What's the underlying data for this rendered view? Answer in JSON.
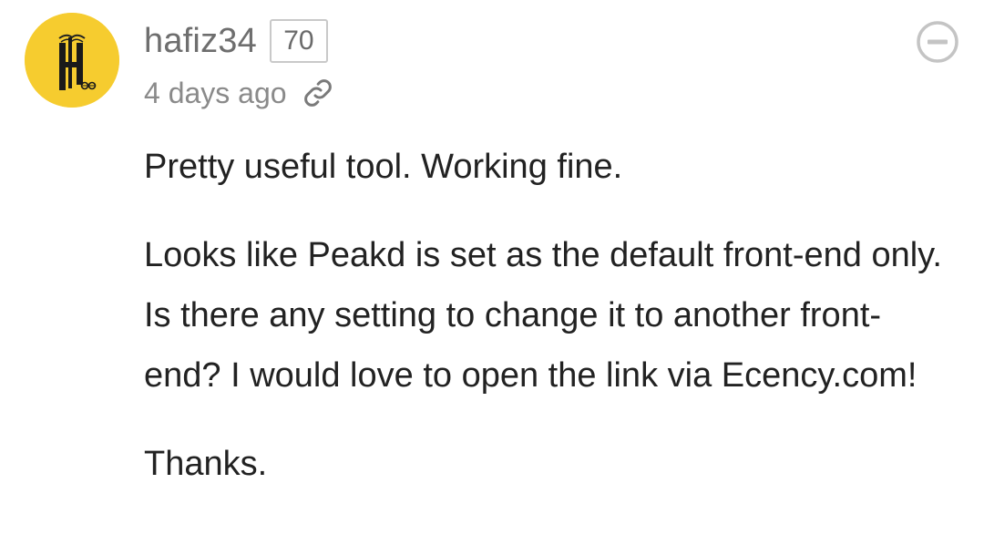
{
  "comment": {
    "author": "hafiz34",
    "reputation": "70",
    "timestamp": "4 days ago",
    "icons": {
      "avatar": "avatar-logo-icon",
      "permalink": "link-icon",
      "collapse": "minus-circle-icon"
    },
    "paragraphs": [
      "Pretty useful tool. Working fine.",
      "Looks like Peakd is set as the default front-end only. Is there any setting to change it to another front-end? I would love to open the link via Ecency.com!",
      "Thanks."
    ]
  },
  "colors": {
    "avatar_bg": "#f6cc2f",
    "text": "#222222",
    "muted": "#8a8a8a",
    "border": "#c9c9c9"
  }
}
